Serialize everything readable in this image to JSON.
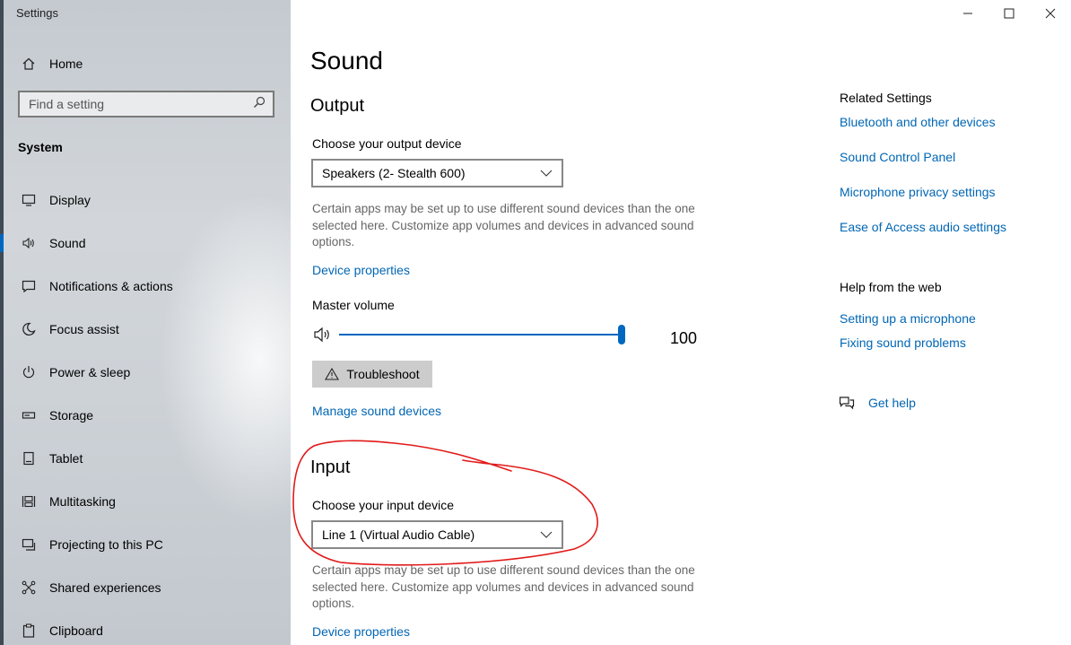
{
  "window": {
    "title": "Settings",
    "minimize_icon": "minimize-icon",
    "maximize_icon": "maximize-icon",
    "close_icon": "close-icon"
  },
  "sidebar": {
    "home": {
      "label": "Home",
      "icon": "home-icon"
    },
    "search": {
      "placeholder": "Find a setting",
      "icon": "search-icon"
    },
    "section": "System",
    "items": [
      {
        "label": "Display",
        "icon": "display-icon"
      },
      {
        "label": "Sound",
        "icon": "speaker-icon",
        "selected": true
      },
      {
        "label": "Notifications & actions",
        "icon": "notifications-icon"
      },
      {
        "label": "Focus assist",
        "icon": "moon-icon"
      },
      {
        "label": "Power & sleep",
        "icon": "power-icon"
      },
      {
        "label": "Storage",
        "icon": "storage-icon"
      },
      {
        "label": "Tablet",
        "icon": "tablet-icon"
      },
      {
        "label": "Multitasking",
        "icon": "multitasking-icon"
      },
      {
        "label": "Projecting to this PC",
        "icon": "projecting-icon"
      },
      {
        "label": "Shared experiences",
        "icon": "shared-icon"
      },
      {
        "label": "Clipboard",
        "icon": "clipboard-icon"
      }
    ],
    "accent": "#0067c0"
  },
  "main": {
    "title": "Sound",
    "output": {
      "heading": "Output",
      "device_label": "Choose your output device",
      "device_value": "Speakers (2- Stealth 600)",
      "description": "Certain apps may be set up to use different sound devices than the one selected here. Customize app volumes and devices in advanced sound options.",
      "device_properties": "Device properties",
      "volume_label": "Master volume",
      "volume_value": "100",
      "volume_level": 1.0,
      "troubleshoot": "Troubleshoot",
      "manage_devices": "Manage sound devices"
    },
    "input": {
      "heading": "Input",
      "device_label": "Choose your input device",
      "device_value": "Line 1 (Virtual Audio Cable)",
      "description": "Certain apps may be set up to use different sound devices than the one selected here. Customize app volumes and devices in advanced sound options.",
      "device_properties": "Device properties"
    },
    "link_color": "#0066b4"
  },
  "related": {
    "title": "Related Settings",
    "links": [
      "Bluetooth and other devices",
      "Sound Control Panel",
      "Microphone privacy settings",
      "Ease of Access audio settings"
    ],
    "help_title": "Help from the web",
    "help_links": [
      "Setting up a microphone",
      "Fixing sound problems"
    ],
    "get_help": "Get help"
  },
  "annotation_color": "#e11a1a"
}
